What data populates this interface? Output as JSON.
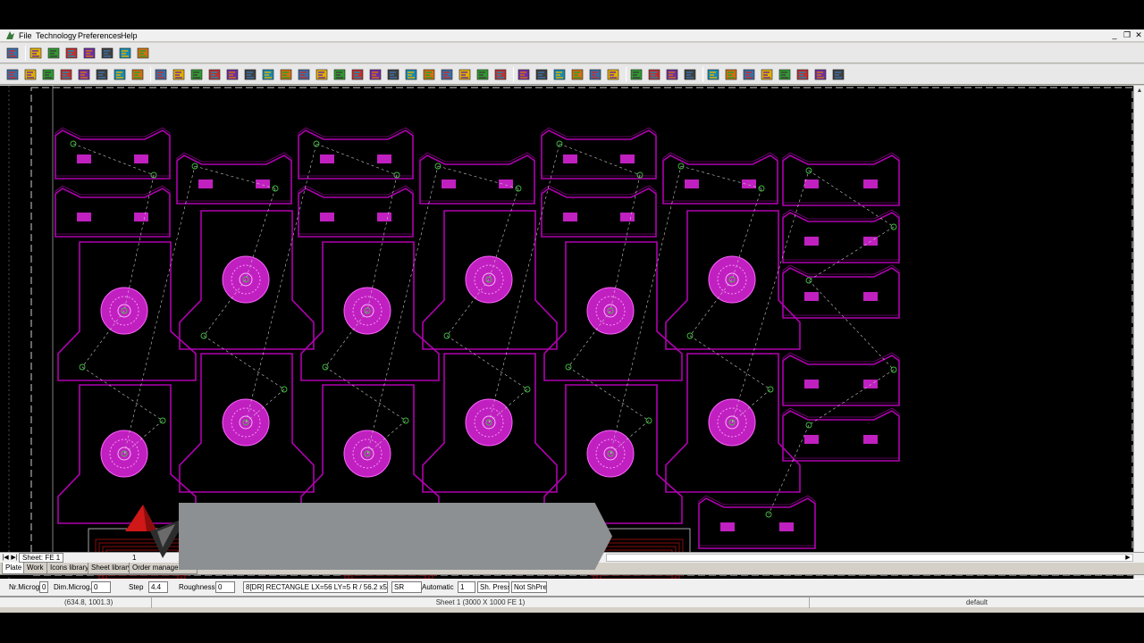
{
  "menu": {
    "items": [
      "File",
      "Technology",
      "Preferences",
      "Help"
    ],
    "window_controls": [
      "_",
      "❐",
      "✕"
    ]
  },
  "toolbar_icons": {
    "row1": [
      "new-icon",
      "save-icon",
      "print-icon",
      "print-preview-icon",
      "export-icon",
      "scan-icon",
      "stop-icon",
      "machine-icon"
    ],
    "row2": [
      "open-part-icon",
      "folder-icon",
      "layers-icon",
      "calc-icon",
      "import-icon",
      "tree-icon",
      "clock-icon",
      "frame-icon",
      "lead-in-icon",
      "lead-out-icon",
      "microjoint-icon",
      "bridge-icon",
      "loop-icon",
      "cut-order-icon",
      "corner-icon",
      "rect-icon",
      "auto-tech-icon",
      "auto-nest-icon",
      "tool-icon",
      "cut-icon",
      "green-block-icon",
      "green-block2-icon",
      "sort-icon",
      "marker-icon",
      "route-icon",
      "path-icon",
      "pierce-icon",
      "edit-icon",
      "grid-icon",
      "grid2-icon",
      "grid3-icon",
      "dot-icon",
      "timer-icon",
      "sim-icon",
      "eraser-icon",
      "delete-icon",
      "undo-icon",
      "redo-icon",
      "machine2-icon",
      "tech-icon",
      "wheel-icon",
      "sheet-icon",
      "gauge-icon",
      "report-icon",
      "send-icon",
      "transfer-icon"
    ]
  },
  "colors": {
    "part_outline": "#b000b0",
    "pierce": "#c020c0",
    "path": "#c8c8c8",
    "lead": "#40c040",
    "sheet_border": "#e0e0e0"
  },
  "sheet_bar": {
    "tab": "Sheet: FE 1",
    "page": "1"
  },
  "tabs": [
    "Plate",
    "Work",
    "Icons library",
    "Sheet library",
    "Order management"
  ],
  "params": {
    "micro_label": "Nr.Microg.",
    "micro_value": "0",
    "dim_label": "Dim.Microg.",
    "dim_value": "0",
    "step_label": "Step",
    "step_value": "4.4",
    "rough_label": "Roughness",
    "rough_value": "0",
    "tool": "8[DR] RECTANGLE LX=56 LY=5  R  / 56.2 x5",
    "sr": "SR",
    "mode": "Automatic",
    "mode_value": "1",
    "sh_press": "Sh. Press",
    "not_sh_press": "Not ShPress"
  },
  "status": {
    "coords": "(634.8, 1001.3)",
    "sheet": "Sheet 1 (3000 X 1000 FE 1)",
    "profile": "default"
  }
}
